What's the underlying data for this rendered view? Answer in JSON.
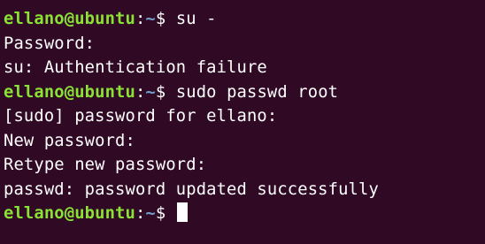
{
  "terminal": {
    "background_color": "#300a24",
    "prompt_user_color": "#8ae234",
    "prompt_path_color": "#729fcf",
    "text_color": "#ffffff",
    "lines": [
      {
        "type": "prompt",
        "user": "ellano@ubuntu",
        "sep": ":",
        "path": "~",
        "symbol": "$ ",
        "command": "su -"
      },
      {
        "type": "output",
        "text": "Password:"
      },
      {
        "type": "output",
        "text": "su: Authentication failure"
      },
      {
        "type": "prompt",
        "user": "ellano@ubuntu",
        "sep": ":",
        "path": "~",
        "symbol": "$ ",
        "command": "sudo passwd root"
      },
      {
        "type": "output",
        "text": "[sudo] password for ellano:"
      },
      {
        "type": "output",
        "text": "New password:"
      },
      {
        "type": "output",
        "text": "Retype new password:"
      },
      {
        "type": "output",
        "text": "passwd: password updated successfully"
      },
      {
        "type": "prompt",
        "user": "ellano@ubuntu",
        "sep": ":",
        "path": "~",
        "symbol": "$ ",
        "command": ""
      }
    ]
  }
}
